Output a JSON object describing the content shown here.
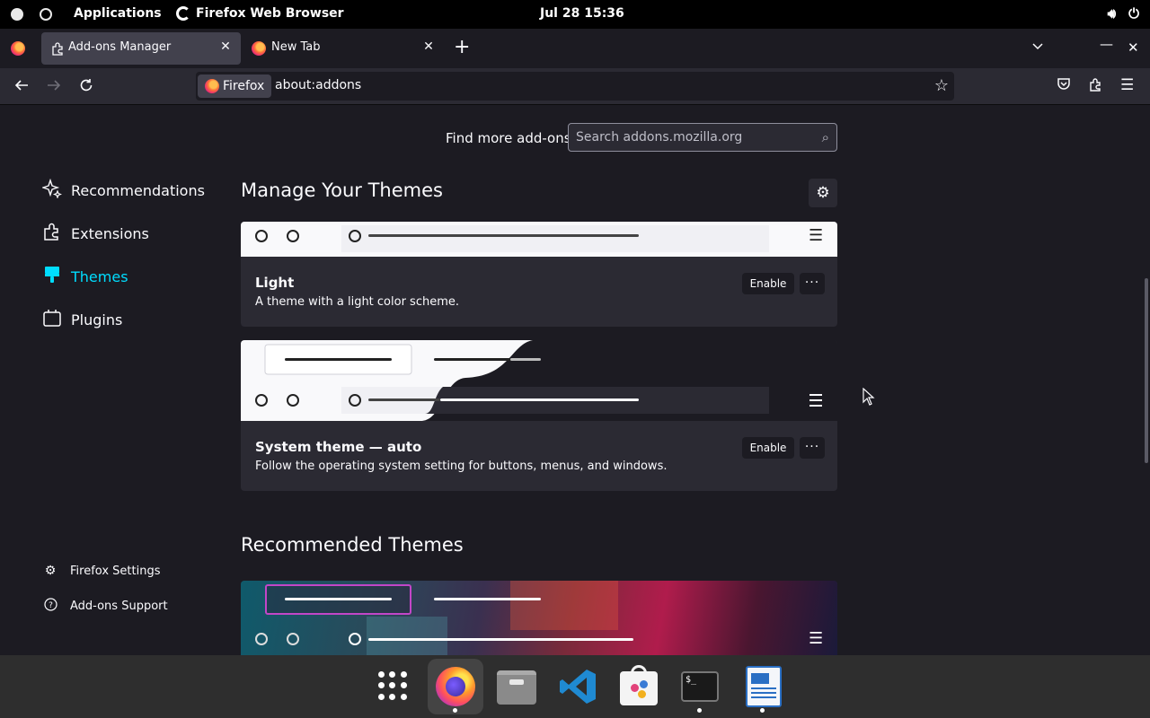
{
  "topbar": {
    "applications": "Applications",
    "app_name": "Firefox Web Browser",
    "clock": "Jul 28  15:36",
    "volume_icon": "volume-icon",
    "power_icon": "power-icon"
  },
  "tabs": [
    {
      "label": "Add-ons Manager",
      "active": true
    },
    {
      "label": "New Tab",
      "active": false
    }
  ],
  "tab_close_glyph": "✕",
  "newtab_glyph": "+",
  "urlbar": {
    "identity_label": "Firefox",
    "url": "about:addons"
  },
  "search": {
    "label": "Find more add-ons",
    "placeholder": "Search addons.mozilla.org"
  },
  "categories": [
    {
      "label": "Recommendations",
      "icon": "sparkle-icon",
      "selected": false
    },
    {
      "label": "Extensions",
      "icon": "puzzle-icon",
      "selected": false
    },
    {
      "label": "Themes",
      "icon": "brush-icon",
      "selected": true
    },
    {
      "label": "Plugins",
      "icon": "plugin-icon",
      "selected": false
    }
  ],
  "footer_links": [
    {
      "label": "Firefox Settings",
      "icon": "gear-icon"
    },
    {
      "label": "Add-ons Support",
      "icon": "help-icon"
    }
  ],
  "manage_title": "Manage Your Themes",
  "themes": [
    {
      "name": "Light",
      "description": "A theme with a light color scheme.",
      "action": "Enable",
      "more": "···"
    },
    {
      "name": "System theme — auto",
      "description": "Follow the operating system setting for buttons, menus, and windows.",
      "action": "Enable",
      "more": "···"
    }
  ],
  "recommended_title": "Recommended Themes",
  "colors": {
    "accent": "#00ddff",
    "background": "#1c1b22",
    "card": "#2b2a33"
  },
  "dock": [
    {
      "name": "show-apps",
      "running": false
    },
    {
      "name": "firefox",
      "running": true
    },
    {
      "name": "files",
      "running": false
    },
    {
      "name": "vscode",
      "running": false
    },
    {
      "name": "software",
      "running": false
    },
    {
      "name": "terminal",
      "running": true
    },
    {
      "name": "text-editor",
      "running": true
    }
  ]
}
